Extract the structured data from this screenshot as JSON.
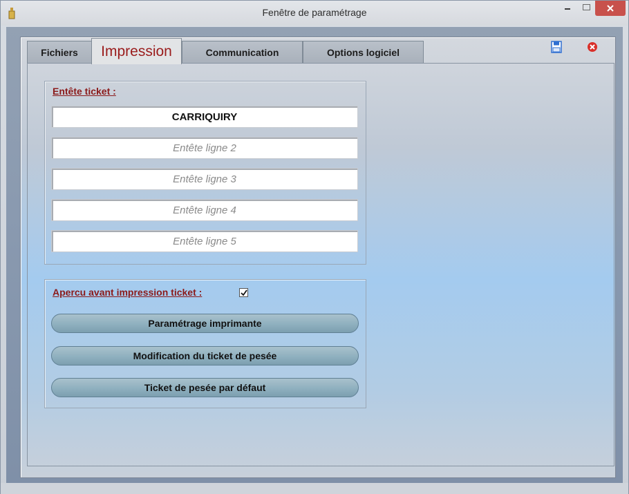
{
  "window": {
    "title": "Fenêtre de paramétrage"
  },
  "tabs": [
    {
      "label": "Fichiers"
    },
    {
      "label": "Impression"
    },
    {
      "label": "Communication"
    },
    {
      "label": "Options logiciel"
    }
  ],
  "header_group": {
    "label": "Entête ticket :",
    "fields": [
      {
        "value": "CARRIQUIRY",
        "placeholder": ""
      },
      {
        "value": "",
        "placeholder": "Entête ligne 2"
      },
      {
        "value": "",
        "placeholder": "Entête ligne 3"
      },
      {
        "value": "",
        "placeholder": "Entête ligne 4"
      },
      {
        "value": "",
        "placeholder": "Entête ligne 5"
      }
    ]
  },
  "print_group": {
    "preview_label": "Apercu avant impression ticket :",
    "preview_checked": true,
    "buttons": [
      {
        "label": "Paramétrage imprimante"
      },
      {
        "label": "Modification du ticket de pesée"
      },
      {
        "label": "Ticket de pesée par défaut"
      }
    ]
  },
  "colors": {
    "accent_label": "#8b1a1a",
    "close_button": "#c8514c",
    "toolbar_close_icon": "#d9302a",
    "toolbar_save_icon": "#2f6fd1"
  },
  "icons": {
    "app": "app-icon",
    "save": "save-icon",
    "close": "close-circle-icon"
  }
}
